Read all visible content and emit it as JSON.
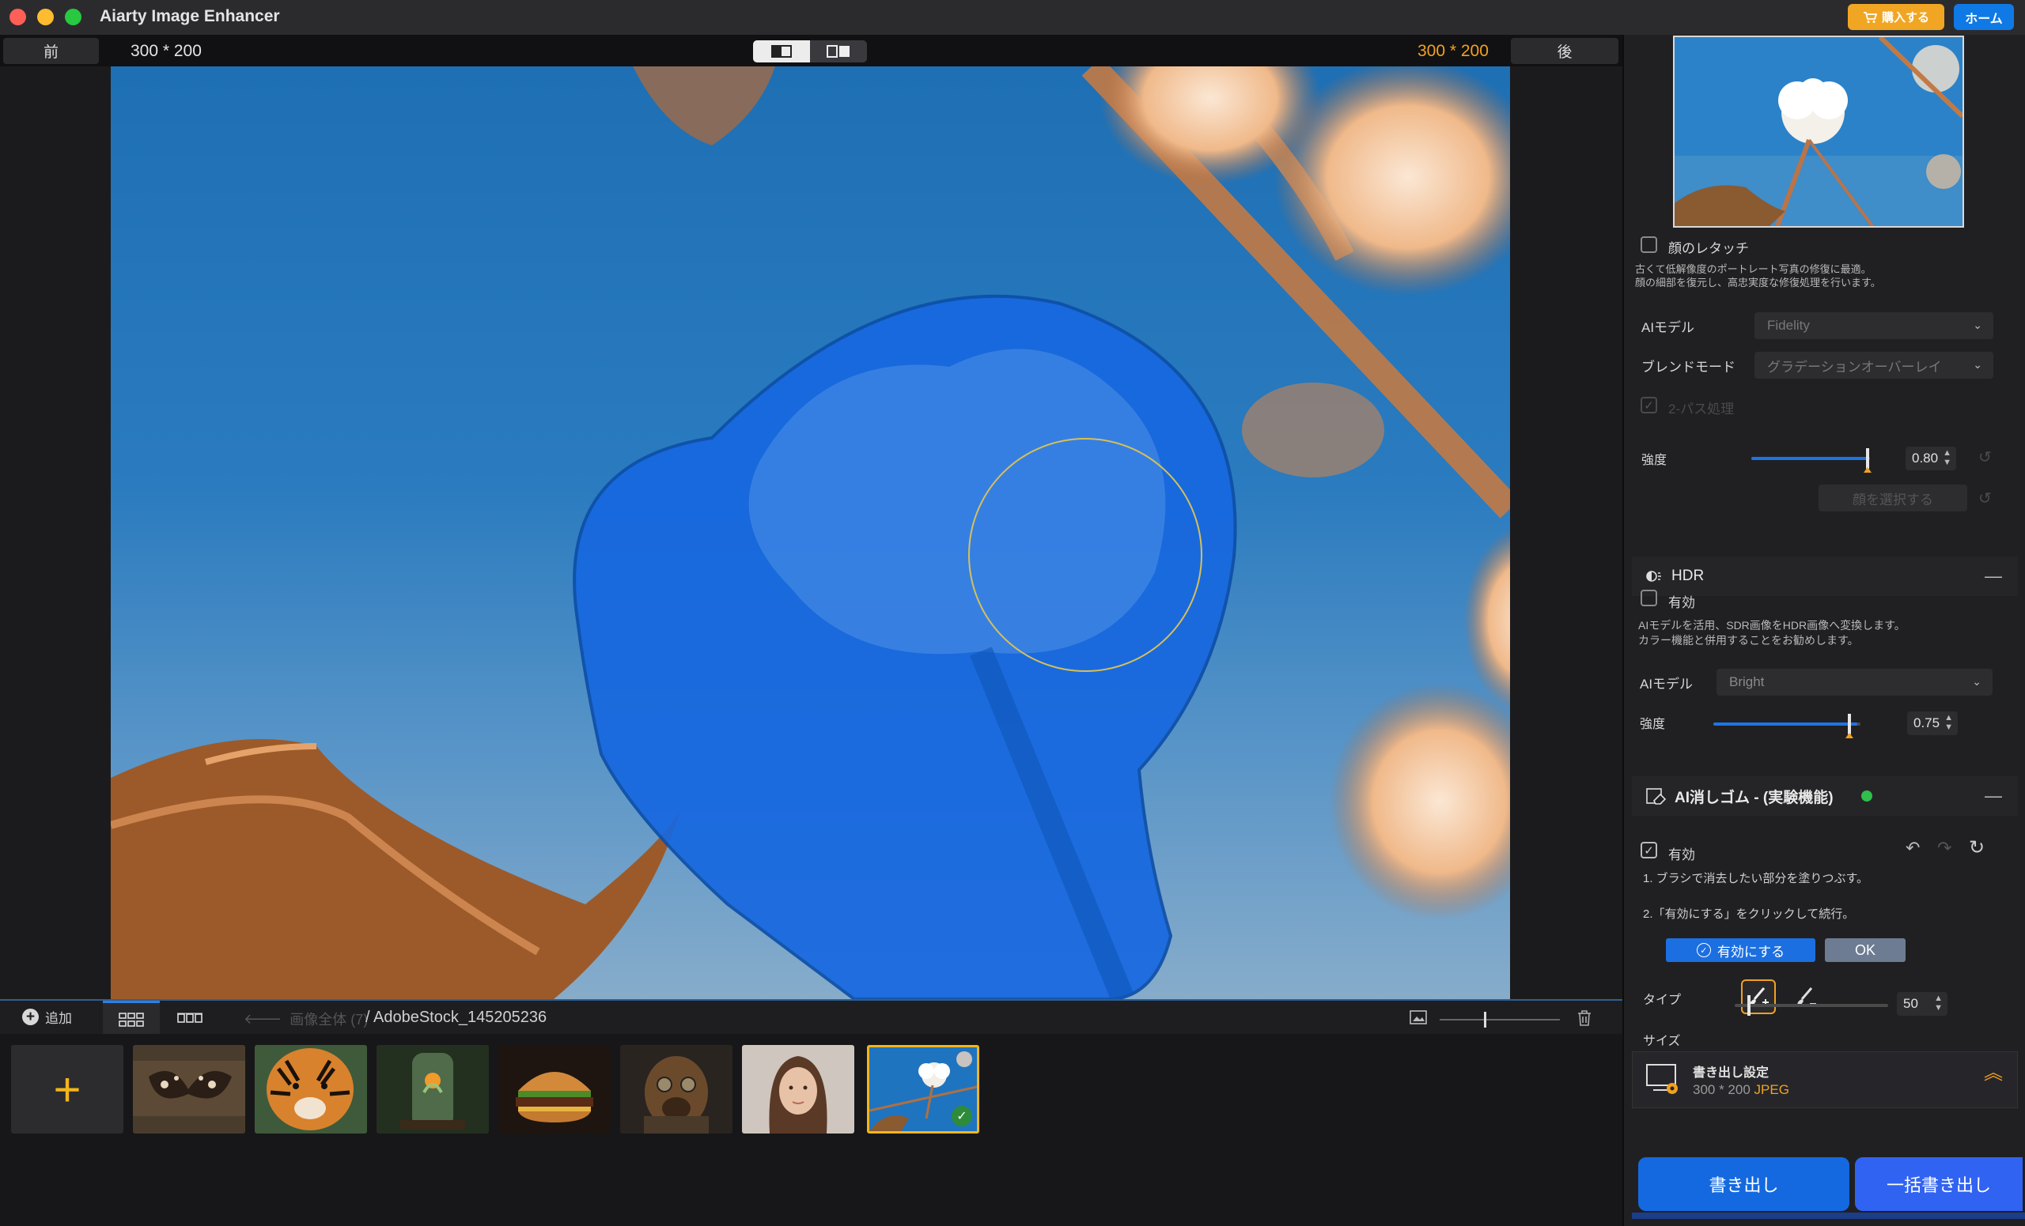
{
  "window": {
    "title": "Aiarty Image Enhancer"
  },
  "header": {
    "buy_label": "購入する",
    "home_label": "ホーム"
  },
  "compare": {
    "before_label": "前",
    "after_label": "後",
    "before_dims": "300 * 200",
    "after_dims": "300 * 200"
  },
  "filmstrip": {
    "add_label": "追加",
    "breadcrumb_all": "画像全体 (7)",
    "breadcrumb_file": "/ AdobeStock_145205236",
    "zoom_level": 0.37,
    "thumbnails": [
      "butterfly",
      "tiger",
      "jar",
      "burger",
      "dog",
      "portrait",
      "cotton"
    ],
    "selected_index": 6
  },
  "panel": {
    "face": {
      "label": "顔のレタッチ",
      "checked": false,
      "desc_line1": "古くて低解像度のポートレート写真の修復に最適。",
      "desc_line2": "顔の細部を復元し、高忠実度な修復処理を行います。",
      "ai_model_label": "AIモデル",
      "ai_model_value": "Fidelity",
      "blend_label": "ブレンドモード",
      "blend_value": "グラデーションオーバーレイ",
      "two_pass_label": "2-パス処理",
      "strength_label": "強度",
      "strength_value": "0.80",
      "select_face_label": "顔を選択する"
    },
    "hdr": {
      "title": "HDR",
      "enable_label": "有効",
      "desc_line1": "AIモデルを活用、SDR画像をHDR画像へ変換します。",
      "desc_line2": "カラー機能と併用することをお勧めします。",
      "ai_model_label": "AIモデル",
      "ai_model_value": "Bright",
      "strength_label": "強度",
      "strength_value": "0.75"
    },
    "eraser": {
      "title": "AI消しゴム - (実験機能)",
      "enable_label": "有効",
      "step1": "1. ブラシで消去したい部分を塗りつぶす。",
      "step2": "2.「有効にする」をクリックして続行。",
      "apply_label": "有効にする",
      "ok_label": "OK",
      "type_label": "タイプ",
      "size_label": "サイズ",
      "size_value": "50"
    },
    "export": {
      "title": "書き出し設定",
      "dims": "300 * 200",
      "format": "JPEG",
      "export_label": "書き出し",
      "batch_label": "一括書き出し"
    }
  }
}
